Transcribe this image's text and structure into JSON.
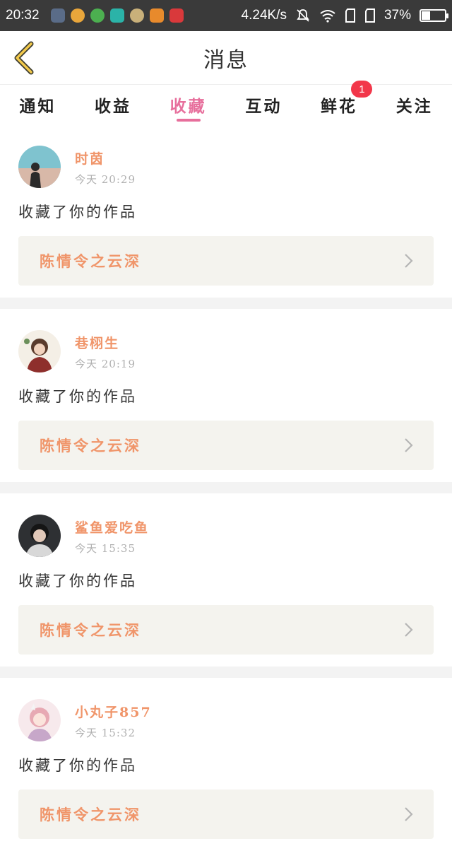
{
  "status_bar": {
    "time": "20:32",
    "network_speed": "4.24K/s",
    "battery": "37%",
    "battery_level": 0.37
  },
  "header": {
    "title": "消息",
    "back_icon": "chevron-left-icon"
  },
  "tabs": [
    {
      "label": "通知",
      "active": false
    },
    {
      "label": "收益",
      "active": false
    },
    {
      "label": "收藏",
      "active": true
    },
    {
      "label": "互动",
      "active": false
    },
    {
      "label": "鲜花",
      "active": false,
      "badge": "1"
    },
    {
      "label": "关注",
      "active": false
    }
  ],
  "colors": {
    "accent": "#e76f9c",
    "name": "#f0956a",
    "badge": "#f2374a",
    "box_bg": "#f4f3ee"
  },
  "notifications": [
    {
      "user": "时茵",
      "time": "今天 20:29",
      "action": "收藏了你的作品",
      "work": "陈情令之云深"
    },
    {
      "user": "巷栩生",
      "time": "今天 20:19",
      "action": "收藏了你的作品",
      "work": "陈情令之云深"
    },
    {
      "user": "鲨鱼爱吃鱼",
      "time": "今天 15:35",
      "action": "收藏了你的作品",
      "work": "陈情令之云深"
    },
    {
      "user": "小丸子857",
      "time": "今天 15:32",
      "action": "收藏了你的作品",
      "work": "陈情令之云深"
    }
  ]
}
